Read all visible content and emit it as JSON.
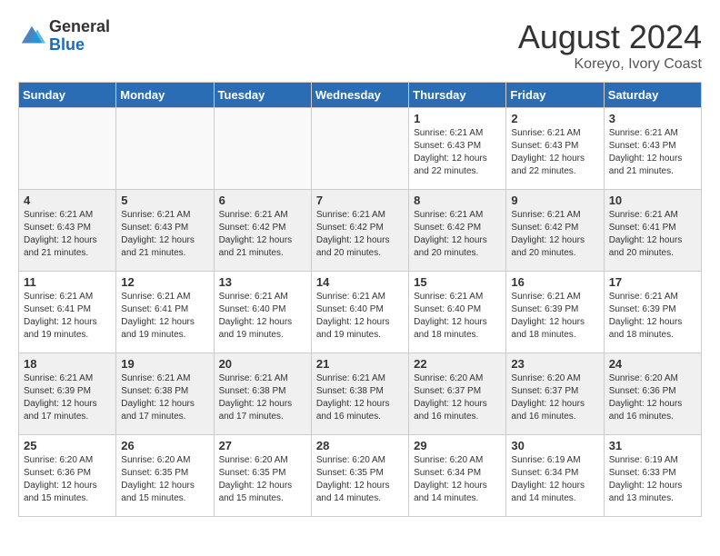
{
  "logo": {
    "general": "General",
    "blue": "Blue"
  },
  "header": {
    "month_year": "August 2024",
    "location": "Koreyo, Ivory Coast"
  },
  "days_of_week": [
    "Sunday",
    "Monday",
    "Tuesday",
    "Wednesday",
    "Thursday",
    "Friday",
    "Saturday"
  ],
  "weeks": [
    [
      {
        "day": "",
        "info": ""
      },
      {
        "day": "",
        "info": ""
      },
      {
        "day": "",
        "info": ""
      },
      {
        "day": "",
        "info": ""
      },
      {
        "day": "1",
        "info": "Sunrise: 6:21 AM\nSunset: 6:43 PM\nDaylight: 12 hours\nand 22 minutes."
      },
      {
        "day": "2",
        "info": "Sunrise: 6:21 AM\nSunset: 6:43 PM\nDaylight: 12 hours\nand 22 minutes."
      },
      {
        "day": "3",
        "info": "Sunrise: 6:21 AM\nSunset: 6:43 PM\nDaylight: 12 hours\nand 21 minutes."
      }
    ],
    [
      {
        "day": "4",
        "info": "Sunrise: 6:21 AM\nSunset: 6:43 PM\nDaylight: 12 hours\nand 21 minutes."
      },
      {
        "day": "5",
        "info": "Sunrise: 6:21 AM\nSunset: 6:43 PM\nDaylight: 12 hours\nand 21 minutes."
      },
      {
        "day": "6",
        "info": "Sunrise: 6:21 AM\nSunset: 6:42 PM\nDaylight: 12 hours\nand 21 minutes."
      },
      {
        "day": "7",
        "info": "Sunrise: 6:21 AM\nSunset: 6:42 PM\nDaylight: 12 hours\nand 20 minutes."
      },
      {
        "day": "8",
        "info": "Sunrise: 6:21 AM\nSunset: 6:42 PM\nDaylight: 12 hours\nand 20 minutes."
      },
      {
        "day": "9",
        "info": "Sunrise: 6:21 AM\nSunset: 6:42 PM\nDaylight: 12 hours\nand 20 minutes."
      },
      {
        "day": "10",
        "info": "Sunrise: 6:21 AM\nSunset: 6:41 PM\nDaylight: 12 hours\nand 20 minutes."
      }
    ],
    [
      {
        "day": "11",
        "info": "Sunrise: 6:21 AM\nSunset: 6:41 PM\nDaylight: 12 hours\nand 19 minutes."
      },
      {
        "day": "12",
        "info": "Sunrise: 6:21 AM\nSunset: 6:41 PM\nDaylight: 12 hours\nand 19 minutes."
      },
      {
        "day": "13",
        "info": "Sunrise: 6:21 AM\nSunset: 6:40 PM\nDaylight: 12 hours\nand 19 minutes."
      },
      {
        "day": "14",
        "info": "Sunrise: 6:21 AM\nSunset: 6:40 PM\nDaylight: 12 hours\nand 19 minutes."
      },
      {
        "day": "15",
        "info": "Sunrise: 6:21 AM\nSunset: 6:40 PM\nDaylight: 12 hours\nand 18 minutes."
      },
      {
        "day": "16",
        "info": "Sunrise: 6:21 AM\nSunset: 6:39 PM\nDaylight: 12 hours\nand 18 minutes."
      },
      {
        "day": "17",
        "info": "Sunrise: 6:21 AM\nSunset: 6:39 PM\nDaylight: 12 hours\nand 18 minutes."
      }
    ],
    [
      {
        "day": "18",
        "info": "Sunrise: 6:21 AM\nSunset: 6:39 PM\nDaylight: 12 hours\nand 17 minutes."
      },
      {
        "day": "19",
        "info": "Sunrise: 6:21 AM\nSunset: 6:38 PM\nDaylight: 12 hours\nand 17 minutes."
      },
      {
        "day": "20",
        "info": "Sunrise: 6:21 AM\nSunset: 6:38 PM\nDaylight: 12 hours\nand 17 minutes."
      },
      {
        "day": "21",
        "info": "Sunrise: 6:21 AM\nSunset: 6:38 PM\nDaylight: 12 hours\nand 16 minutes."
      },
      {
        "day": "22",
        "info": "Sunrise: 6:20 AM\nSunset: 6:37 PM\nDaylight: 12 hours\nand 16 minutes."
      },
      {
        "day": "23",
        "info": "Sunrise: 6:20 AM\nSunset: 6:37 PM\nDaylight: 12 hours\nand 16 minutes."
      },
      {
        "day": "24",
        "info": "Sunrise: 6:20 AM\nSunset: 6:36 PM\nDaylight: 12 hours\nand 16 minutes."
      }
    ],
    [
      {
        "day": "25",
        "info": "Sunrise: 6:20 AM\nSunset: 6:36 PM\nDaylight: 12 hours\nand 15 minutes."
      },
      {
        "day": "26",
        "info": "Sunrise: 6:20 AM\nSunset: 6:35 PM\nDaylight: 12 hours\nand 15 minutes."
      },
      {
        "day": "27",
        "info": "Sunrise: 6:20 AM\nSunset: 6:35 PM\nDaylight: 12 hours\nand 15 minutes."
      },
      {
        "day": "28",
        "info": "Sunrise: 6:20 AM\nSunset: 6:35 PM\nDaylight: 12 hours\nand 14 minutes."
      },
      {
        "day": "29",
        "info": "Sunrise: 6:20 AM\nSunset: 6:34 PM\nDaylight: 12 hours\nand 14 minutes."
      },
      {
        "day": "30",
        "info": "Sunrise: 6:19 AM\nSunset: 6:34 PM\nDaylight: 12 hours\nand 14 minutes."
      },
      {
        "day": "31",
        "info": "Sunrise: 6:19 AM\nSunset: 6:33 PM\nDaylight: 12 hours\nand 13 minutes."
      }
    ]
  ]
}
